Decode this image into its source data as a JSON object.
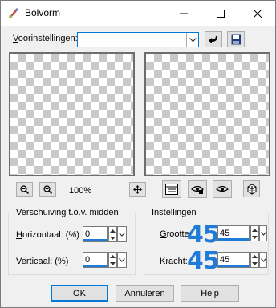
{
  "window": {
    "title": "Bolvorm",
    "minimize_glyph": "—",
    "maximize_glyph": "☐",
    "close_glyph": "✕"
  },
  "presets": {
    "label_prefix": "V",
    "label_rest": "oorinstellingen:",
    "value": ""
  },
  "zoom": {
    "level": "100%"
  },
  "offset_group": {
    "title": "Verschuiving t.o.v. midden",
    "horizontal_label_u": "H",
    "horizontal_label_rest": "orizontaal: (%)",
    "horizontal_value": "0",
    "vertical_label_u": "V",
    "vertical_label_rest": "erticaal: (%)",
    "vertical_value": "0"
  },
  "settings_group": {
    "title": "Instellingen",
    "size_label_u": "G",
    "size_label_rest": "rootte:",
    "size_value": "45",
    "size_big": "45",
    "strength_label_u": "K",
    "strength_label_rest": "racht:",
    "strength_value": "45",
    "strength_big": "45"
  },
  "buttons": {
    "ok": "OK",
    "cancel": "Annuleren",
    "help": "Help"
  },
  "colors": {
    "accent": "#1e7bd8",
    "focus": "#0078d7"
  }
}
